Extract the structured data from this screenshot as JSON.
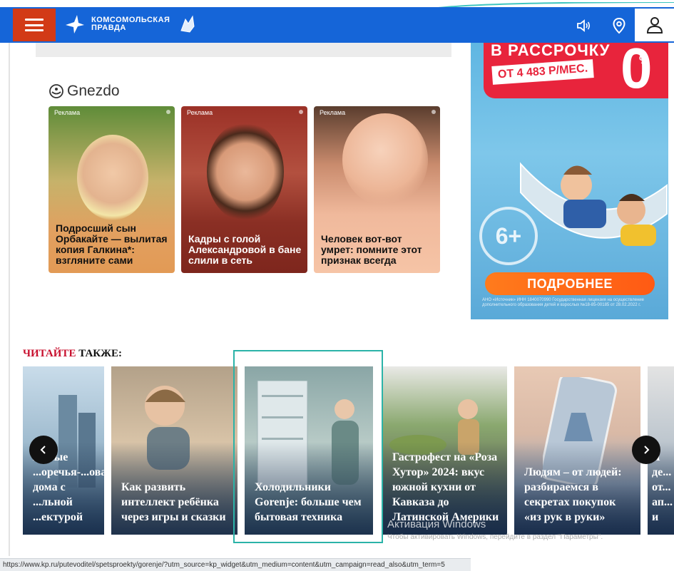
{
  "header": {
    "logo_line1": "КОМСОМОЛЬСКАЯ",
    "logo_line2": "ПРАВДА",
    "colors": {
      "bar": "#1565d8",
      "menu": "#d23a16"
    },
    "icons": [
      "menu-icon",
      "sound-icon",
      "location-pin-icon",
      "user-icon"
    ]
  },
  "gnezdo": {
    "brand": "Gnezdo",
    "cards": [
      {
        "tag": "Реклама",
        "caption": "Подросший сын Орбакайте — вылитая копия Галкина*: взгляните сами"
      },
      {
        "tag": "Реклама",
        "caption": "Кадры с голой Александровой в бане слили в сеть"
      },
      {
        "tag": "Реклама",
        "caption": "Человек вот-вот умрет: помните этот признак всегда"
      }
    ]
  },
  "banner": {
    "title": "В РАССРОЧКУ",
    "price": "ОТ 4 483 Р/МЕС.",
    "zero": "0",
    "percent": "%",
    "age": "6+",
    "button": "ПОДРОБНЕЕ",
    "fine_print": "АНО «Источник» ИНН 1840070990 Государственная лицензия на осуществление дополнительного образования детей и взрослых №18-85-00185 от 28.02.2022 г."
  },
  "read_also": {
    "label_red": "ЧИТАЙТЕ",
    "label_black": "ТАКЖЕ:",
    "cards": [
      {
        "title": "жилые ...оречья-...ова: дома с ...льной ...ектурой"
      },
      {
        "title": "Как развить интеллект ребёнка через игры и сказки"
      },
      {
        "title": "Холодильники Gorenje: больше чем бытовая техника"
      },
      {
        "title": "Гастрофест на «Роза Хутор» 2024: вкус южной кухни от Кавказа до Латинской Америки"
      },
      {
        "title": "Людям – от людей: разбираемся в секретах покупок «из рук в руки»"
      },
      {
        "title": "Я де... от... ап... и"
      }
    ]
  },
  "windows_watermark": {
    "title": "Активация Windows",
    "subtitle": "Чтобы активировать Windows, перейдите в раздел \"Параметры\"."
  },
  "status_bar": {
    "url": "https://www.kp.ru/putevoditel/spetsproekty/gorenje/?utm_source=kp_widget&utm_medium=content&utm_campaign=read_also&utm_term=5"
  }
}
